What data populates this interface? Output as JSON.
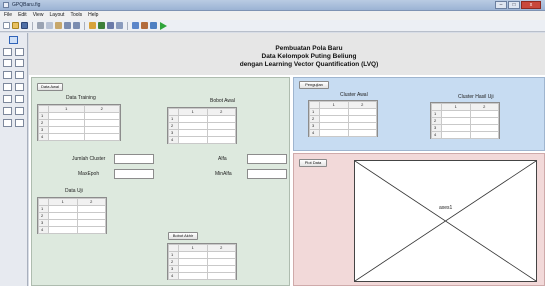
{
  "window": {
    "title": "GPQBaru.fig"
  },
  "window_buttons": [
    "–",
    "□",
    "x"
  ],
  "menu": [
    "File",
    "Edit",
    "View",
    "Layout",
    "Tools",
    "Help"
  ],
  "header": {
    "line1": "Pembuatan Pola Baru",
    "line2": "Data Kelompok Puting Beliung",
    "line3": "dengan Learning Vector Quantification (LVQ)"
  },
  "left_panel": {
    "data_awal_button": "Data Awal",
    "data_training_title": "Data Training",
    "bobot_awal_title": "Bobot Awal",
    "jumlah_cluster_label": "Jumlah Cluster",
    "maxepoh_label": "MaxEpoh",
    "alfa_label": "Alfa",
    "minalfa_label": "MinAlfa",
    "data_uji_title": "Data Uji",
    "bobot_akhir_button": "Bobot Akhir"
  },
  "cluster_panel": {
    "pengujian_button": "Pengujian",
    "cluster_awal_title": "Cluster Awal",
    "cluster_hasil_title": "Cluster Hasil Uji"
  },
  "plot_panel": {
    "plot_button": "Plot Data",
    "axes_tag": "axes1"
  },
  "table": {
    "col_headers": [
      "1",
      "2"
    ],
    "row_headers": [
      "1",
      "2",
      "3",
      "4"
    ]
  },
  "colors": {
    "left_panel": "#dde9de",
    "cluster_panel": "#c7dcf2",
    "plot_panel": "#f2d9d9",
    "header_area": "#e6e6e6"
  }
}
